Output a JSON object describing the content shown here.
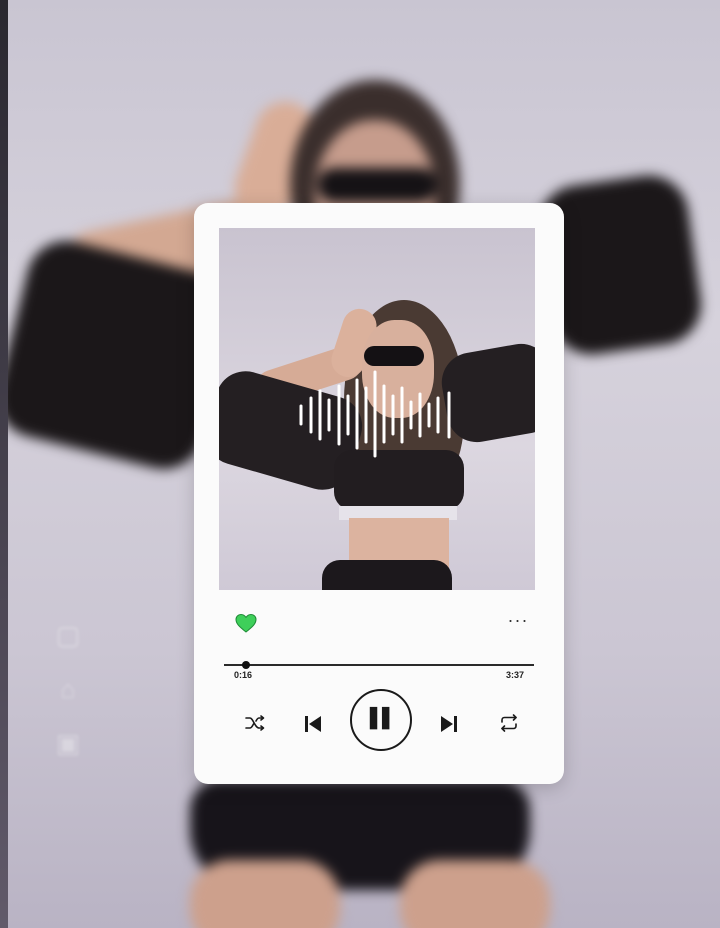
{
  "player": {
    "current_time": "0:16",
    "total_time": "3:37",
    "progress_fraction": 0.07,
    "liked": true,
    "more_label": "···"
  },
  "colors": {
    "heart": "#3ecf5a",
    "controls": "#1a1a1a",
    "card": "#fbfbfb"
  },
  "icons": {
    "heart": "heart-icon",
    "more": "more-options-icon",
    "shuffle": "shuffle-icon",
    "previous": "skip-previous-icon",
    "pause": "pause-icon",
    "next": "skip-next-icon",
    "repeat": "repeat-icon",
    "soundwave": "soundwave-icon"
  }
}
